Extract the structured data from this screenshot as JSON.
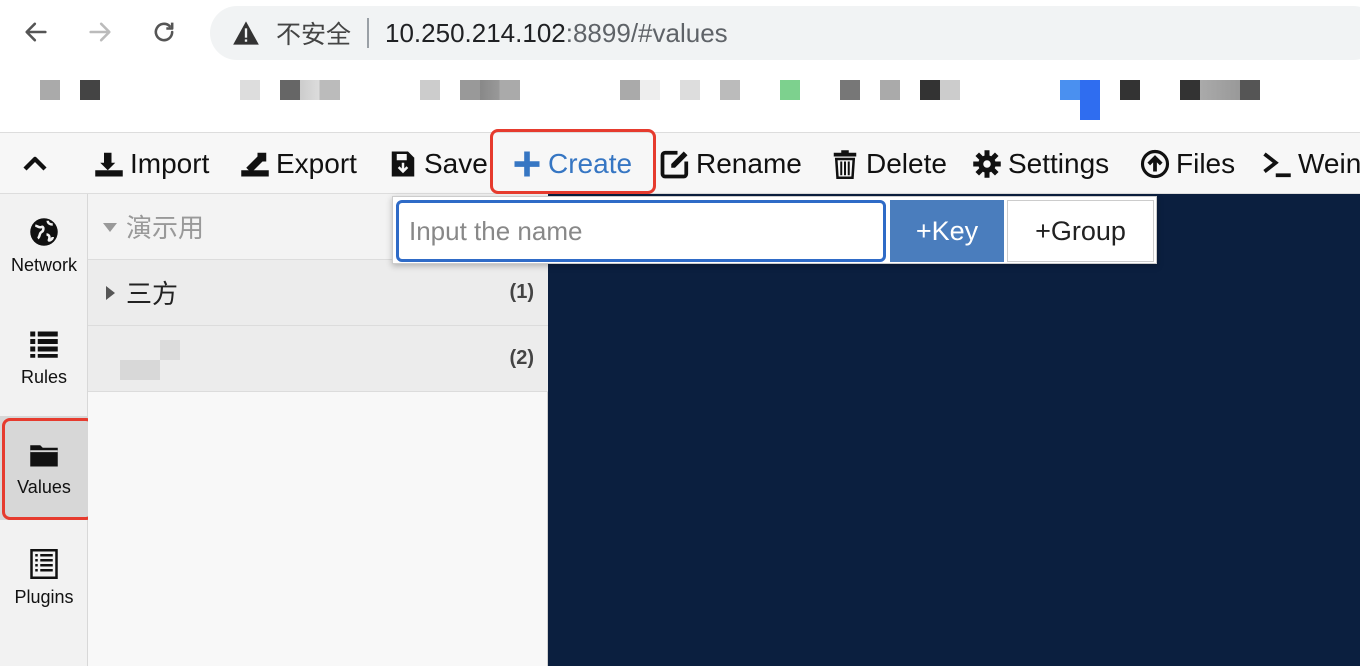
{
  "browser": {
    "security_warning": "不安全",
    "url_host": "10.250.214.102",
    "url_rest": ":8899/#values"
  },
  "toolbar": {
    "import_label": "Import",
    "export_label": "Export",
    "save_label": "Save",
    "create_label": "Create",
    "rename_label": "Rename",
    "delete_label": "Delete",
    "settings_label": "Settings",
    "files_label": "Files",
    "weinre_label": "Weinr"
  },
  "rail": {
    "items": [
      {
        "label": "Network",
        "icon": "globe-icon"
      },
      {
        "label": "Rules",
        "icon": "list-icon"
      },
      {
        "label": "Values",
        "icon": "folder-icon",
        "active": true
      },
      {
        "label": "Plugins",
        "icon": "document-list-icon"
      }
    ]
  },
  "tree": {
    "root_label": "演示用",
    "groups": [
      {
        "label": "三方",
        "count": "(1)"
      },
      {
        "label": "",
        "count": "(2)"
      }
    ]
  },
  "create_popup": {
    "input_placeholder": "Input the name",
    "key_button": "+Key",
    "group_button": "+Group"
  },
  "colors": {
    "accent": "#3676c3",
    "highlight": "#e63b2e",
    "editor_bg": "#0b1f3f"
  }
}
